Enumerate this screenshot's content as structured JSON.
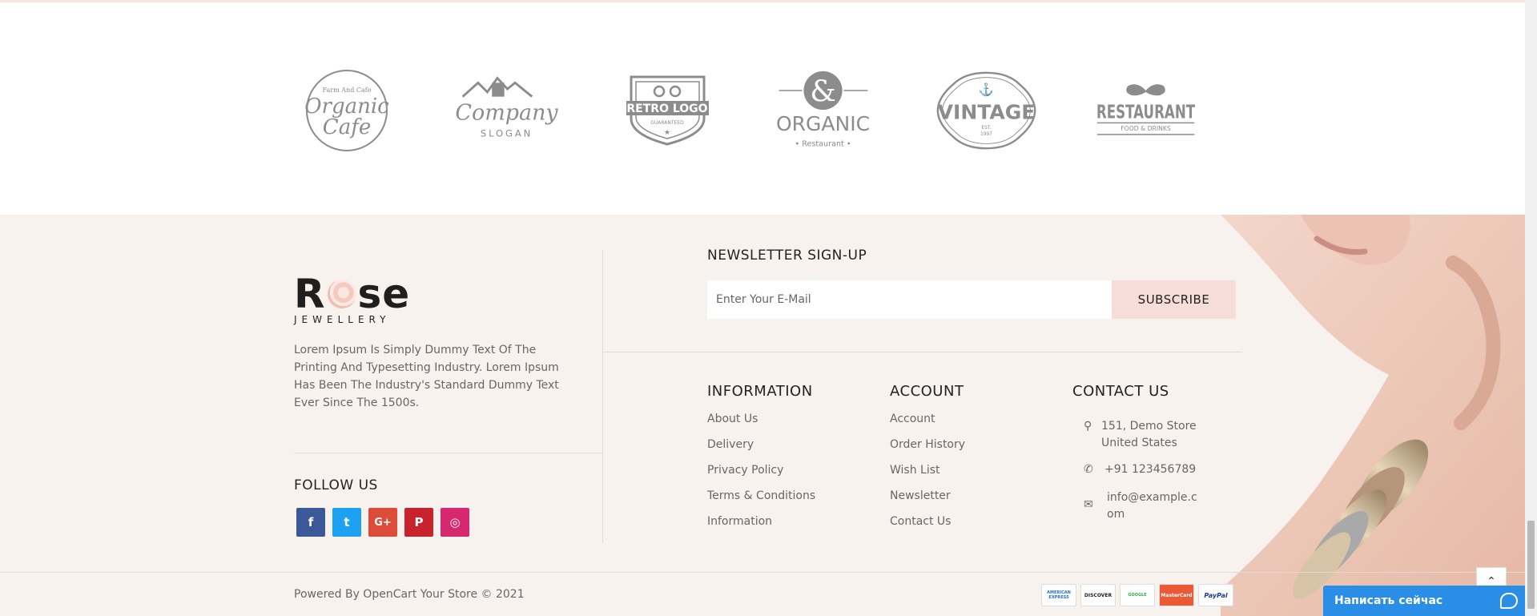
{
  "brands": [
    {
      "name": "organic-cafe",
      "line1": "Farm And Cafe",
      "line2": "Organic",
      "line3": "Cafe"
    },
    {
      "name": "company-slogan",
      "line1": "Company",
      "line2": "SLOGAN"
    },
    {
      "name": "retro-logo",
      "line1": "RETRO LOGO",
      "line2": "GUARANTEED"
    },
    {
      "name": "organic-restaurant",
      "line1": "&",
      "line2": "ORGANIC",
      "line3": "• Restaurant •"
    },
    {
      "name": "vintage",
      "line1": "VINTAGE",
      "line2": "EST.",
      "line3": "1997"
    },
    {
      "name": "restaurant",
      "line1": "RESTAURANT",
      "line2": "FOOD & DRINKS"
    }
  ],
  "logo": {
    "word_start": "R",
    "word_end": "se",
    "subtitle": "JEWELLERY"
  },
  "about_text": "Lorem Ipsum Is Simply Dummy Text Of The Printing And Typesetting Industry. Lorem Ipsum Has Been The Industry's Standard Dummy Text Ever Since The 1500s.",
  "follow": {
    "title": "FOLLOW US",
    "items": [
      {
        "name": "facebook",
        "glyph": "f",
        "color": "#3b5998"
      },
      {
        "name": "twitter",
        "glyph": "t",
        "color": "#1da1f2"
      },
      {
        "name": "google-plus",
        "glyph": "G+",
        "color": "#dd4b39"
      },
      {
        "name": "pinterest",
        "glyph": "P",
        "color": "#c8232c"
      },
      {
        "name": "instagram",
        "glyph": "◎",
        "color": "#d6286e"
      }
    ]
  },
  "newsletter": {
    "title": "NEWSLETTER SIGN-UP",
    "placeholder": "Enter Your E-Mail",
    "button": "SUBSCRIBE"
  },
  "information": {
    "title": "INFORMATION",
    "links": [
      "About Us",
      "Delivery",
      "Privacy Policy",
      "Terms & Conditions",
      "Information"
    ]
  },
  "account": {
    "title": "ACCOUNT",
    "links": [
      "Account",
      "Order History",
      "Wish List",
      "Newsletter",
      "Contact Us"
    ]
  },
  "contact": {
    "title": "CONTACT US",
    "address_line1": "151, Demo Store",
    "address_line2": "United States",
    "phone": "+91 123456789",
    "email_line1": "info@example.c",
    "email_line2": "om"
  },
  "powered": "Powered By OpenCart Your Store © 2021",
  "payments": [
    "AMERICAN EXPRESS",
    "DISCOVER",
    "GOOGLE",
    "MasterCard",
    "PayPal"
  ],
  "chat": {
    "label": "Написать сейчас"
  },
  "colors": {
    "footer_bg": "#f8f2ef",
    "accent": "#f7ddd7",
    "chat": "#2a8ee6"
  }
}
